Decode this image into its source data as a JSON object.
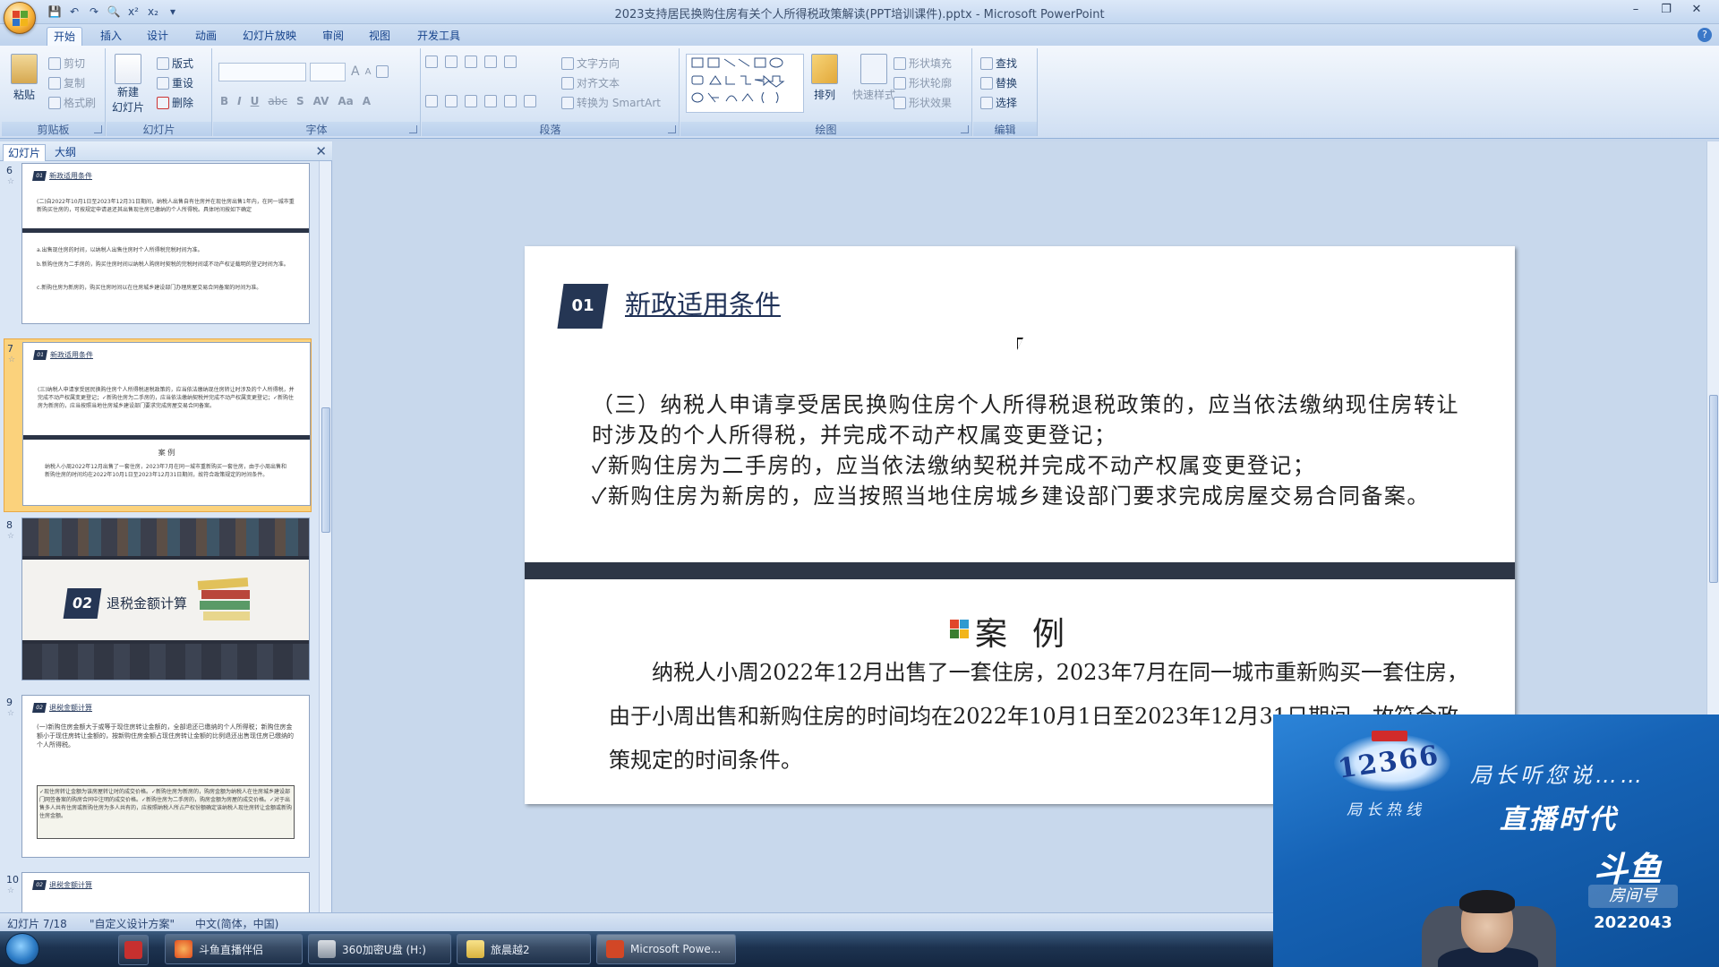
{
  "window": {
    "title": "2023支持居民换购住房有关个人所得税政策解读(PPT培训课件).pptx - Microsoft PowerPoint",
    "minimize": "–",
    "restore": "❐",
    "close": "✕"
  },
  "qat": [
    "💾",
    "↶",
    "↷",
    "🔍",
    "x²",
    "x₂",
    "▾"
  ],
  "tabs": [
    "开始",
    "插入",
    "设计",
    "动画",
    "幻灯片放映",
    "审阅",
    "视图",
    "开发工具"
  ],
  "active_tab": "开始",
  "ribbon": {
    "clipboard": {
      "label": "剪贴板",
      "paste": "粘贴",
      "cut": "剪切",
      "copy": "复制",
      "format_painter": "格式刷"
    },
    "slides": {
      "label": "幻灯片",
      "new_slide": "新建",
      "new_slide2": "幻灯片",
      "layout": "版式",
      "reset": "重设",
      "delete": "删除"
    },
    "font": {
      "label": "字体",
      "bold": "B",
      "italic": "I",
      "underline": "U",
      "strike": "abc",
      "shadow": "S",
      "spacing": "AV",
      "case": "Aa",
      "color": "A",
      "grow": "A",
      "shrink": "A"
    },
    "paragraph": {
      "label": "段落",
      "direction": "文字方向",
      "align_text": "对齐文本",
      "smartart": "转换为 SmartArt"
    },
    "drawing": {
      "label": "绘图",
      "arrange": "排列",
      "quick_styles": "快速样式",
      "fill": "形状填充",
      "outline": "形状轮廓",
      "effects": "形状效果"
    },
    "editing": {
      "label": "编辑",
      "find": "查找",
      "replace": "替换",
      "select": "选择"
    }
  },
  "left_panel": {
    "tab_slides": "幻灯片",
    "tab_outline": "大纲",
    "close": "✕",
    "thumbs": [
      {
        "num": "6",
        "badge": "01",
        "title": "新政适用条件",
        "text1": "(二)自2022年10月1日至2023年12月31日期间，纳税人出售自有住房并在现住房出售1年内，在同一城市重新购买住房的，可按规定申请退还其出售现住房已缴纳的个人所得税。具体时间按如下确定",
        "text2": "a.出售现住房的时间，以纳税人出售住房时个人所得税完税时间为准。",
        "text3": "b.新购住房为二手房的，购买住房时间以纳税人购房时契税的完税时间或不动产权证载明的登记时间为准。",
        "text4": "c.新购住房为新房的，购买住房时间以在住房城乡建设部门办理房屋交易合同备案的时间为准。"
      },
      {
        "num": "7",
        "badge": "01",
        "title": "新政适用条件",
        "text1": "(三)纳税人申请享受居民换购住房个人所得税退税政策的，应当依法缴纳现住房转让时涉及的个人所得税，并完成不动产权属变更登记；✓新购住房为二手房的，应当依法缴纳契税并完成不动产权属变更登记；✓新购住房为新房的，应当按照当地住房城乡建设部门要求完成房屋交易合同备案。",
        "case_title": "案 例",
        "case_text": "纳税人小周2022年12月出售了一套住房，2023年7月在同一城市重新购买一套住房，由于小周出售和新购住房的时间均在2022年10月1日至2023年12月31日期间，故符合政策规定的时间条件。"
      },
      {
        "num": "8",
        "badge": "02",
        "title": "退税金额计算"
      },
      {
        "num": "9",
        "badge": "02",
        "title": "退税金额计算",
        "text1": "(一)新购住房金额大于或等于现住房转让金额的，全部退还已缴纳的个人所得税；新购住房金额小于现住房转让金额的，按新购住房金额占现住房转让金额的比例退还出售现住房已缴纳的个人所得税。",
        "text2": "✓现住房转让金额为该房屋转让时的成交价格。✓新购住房为新房的，购房金额为纳税人在住房城乡建设部门网签备案的购房合同中注明的成交价格。✓新购住房为二手房的，购房金额为房屋的成交价格。✓对于出售多人共有住房或新购住房为多人共有的，应按照纳税人所占产权份额确定该纳税人现住房转让金额或新购住房金额。"
      },
      {
        "num": "10",
        "badge": "02",
        "title": "退税金额计算"
      }
    ],
    "star": "☆"
  },
  "slide": {
    "badge": "01",
    "title": "新政适用条件",
    "body_line1": "（三）纳税人申请享受居民换购住房个人所得税退税政策的，应当依法缴纳现住房转让时涉及的个人所得税，并完成不动产权属变更登记；",
    "body_line2": "✓新购住房为二手房的，应当依法缴纳契税并完成不动产权属变更登记；",
    "body_line3": "✓新购住房为新房的，应当按照当地住房城乡建设部门要求完成房屋交易合同备案。",
    "case_title": "案例",
    "case_body": "纳税人小周2022年12月出售了一套住房，2023年7月在同一城市重新购买一套住房，由于小周出售和新购住房的时间均在2022年10月1日至2023年12月31日期间，故符合政策规定的时间条件。"
  },
  "status": {
    "slide_info": "幻灯片 7/18",
    "theme": "\"自定义设计方案\"",
    "language": "中文(简体，中国)"
  },
  "taskbar": {
    "items": [
      "斗鱼直播伴侣",
      "360加密U盘 (H:)",
      "旅晨越2",
      "Microsoft Powe..."
    ]
  },
  "webcam": {
    "logo_number": "12366",
    "subtitle": "局长热线",
    "slogan": "局长听您说……",
    "era": "直播时代",
    "brand": "斗鱼",
    "room_label": "房间号",
    "room_number": "2022043"
  },
  "colors": {
    "slide_navy": "#253654",
    "ribbon_blue": "#dbe7f6",
    "selected_thumb": "#fbd27c",
    "webcam_blue": "#1663b6"
  }
}
